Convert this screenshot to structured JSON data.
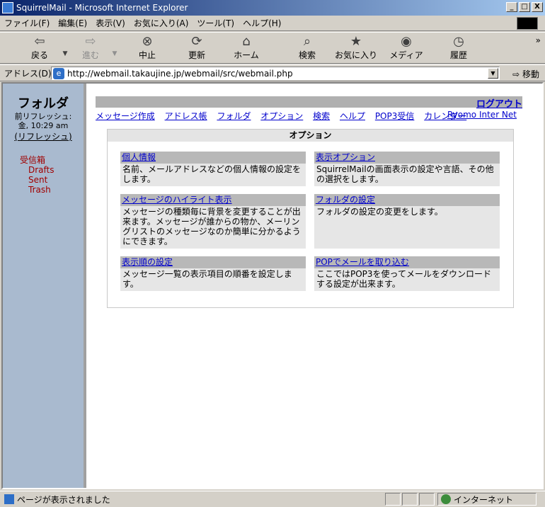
{
  "window": {
    "title": "SquirrelMail - Microsoft Internet Explorer",
    "buttons": [
      "_",
      "□",
      "X"
    ]
  },
  "menu": [
    "ファイル(F)",
    "編集(E)",
    "表示(V)",
    "お気に入り(A)",
    "ツール(T)",
    "ヘルプ(H)"
  ],
  "toolbar": {
    "back": "戻る",
    "forward": "進む",
    "stop": "中止",
    "refresh": "更新",
    "home": "ホーム",
    "search": "検索",
    "favorites": "お気に入り",
    "media": "メディア",
    "history": "履歴",
    "more": "»"
  },
  "address": {
    "label": "アドレス(D)",
    "url": "http://webmail.takaujine.jp/webmail/src/webmail.php",
    "go": "移動"
  },
  "leftpane": {
    "title": "フォルダ",
    "last_refresh_label": "前リフレッシュ:",
    "last_refresh_time": "金, 10:29 am",
    "refresh_link": "(リフレッシュ)",
    "folders": [
      "受信箱",
      "Drafts",
      "Sent",
      "Trash"
    ]
  },
  "main": {
    "logout": "ログアウト",
    "nav": [
      "メッセージ作成",
      "アドレス帳",
      "フォルダ",
      "オプション",
      "検索",
      "ヘルプ",
      "POP3受信",
      "カレンダー"
    ],
    "org_link": "Ryomo Inter Net",
    "options_title": "オプション",
    "cells": [
      {
        "title": "個人情報",
        "desc": "名前、メールアドレスなどの個人情報の設定をします。"
      },
      {
        "title": "表示オプション",
        "desc": "SquirrelMailの画面表示の設定や言語、その他の選択をします。"
      },
      {
        "title": "メッセージのハイライト表示",
        "desc": "メッセージの種類毎に背景を変更することが出来ます。メッセージが誰からの物か、メーリングリストのメッセージなのか簡単に分かるようにできます。"
      },
      {
        "title": "フォルダの設定",
        "desc": "フォルダの設定の変更をします。"
      },
      {
        "title": "表示順の設定",
        "desc": "メッセージ一覧の表示項目の順番を設定します。"
      },
      {
        "title": "POPでメールを取り込む",
        "desc": "ここではPOP3を使ってメールをダウンロードする設定が出来ます。"
      }
    ]
  },
  "status": {
    "text": "ページが表示されました",
    "zone": "インターネット"
  }
}
